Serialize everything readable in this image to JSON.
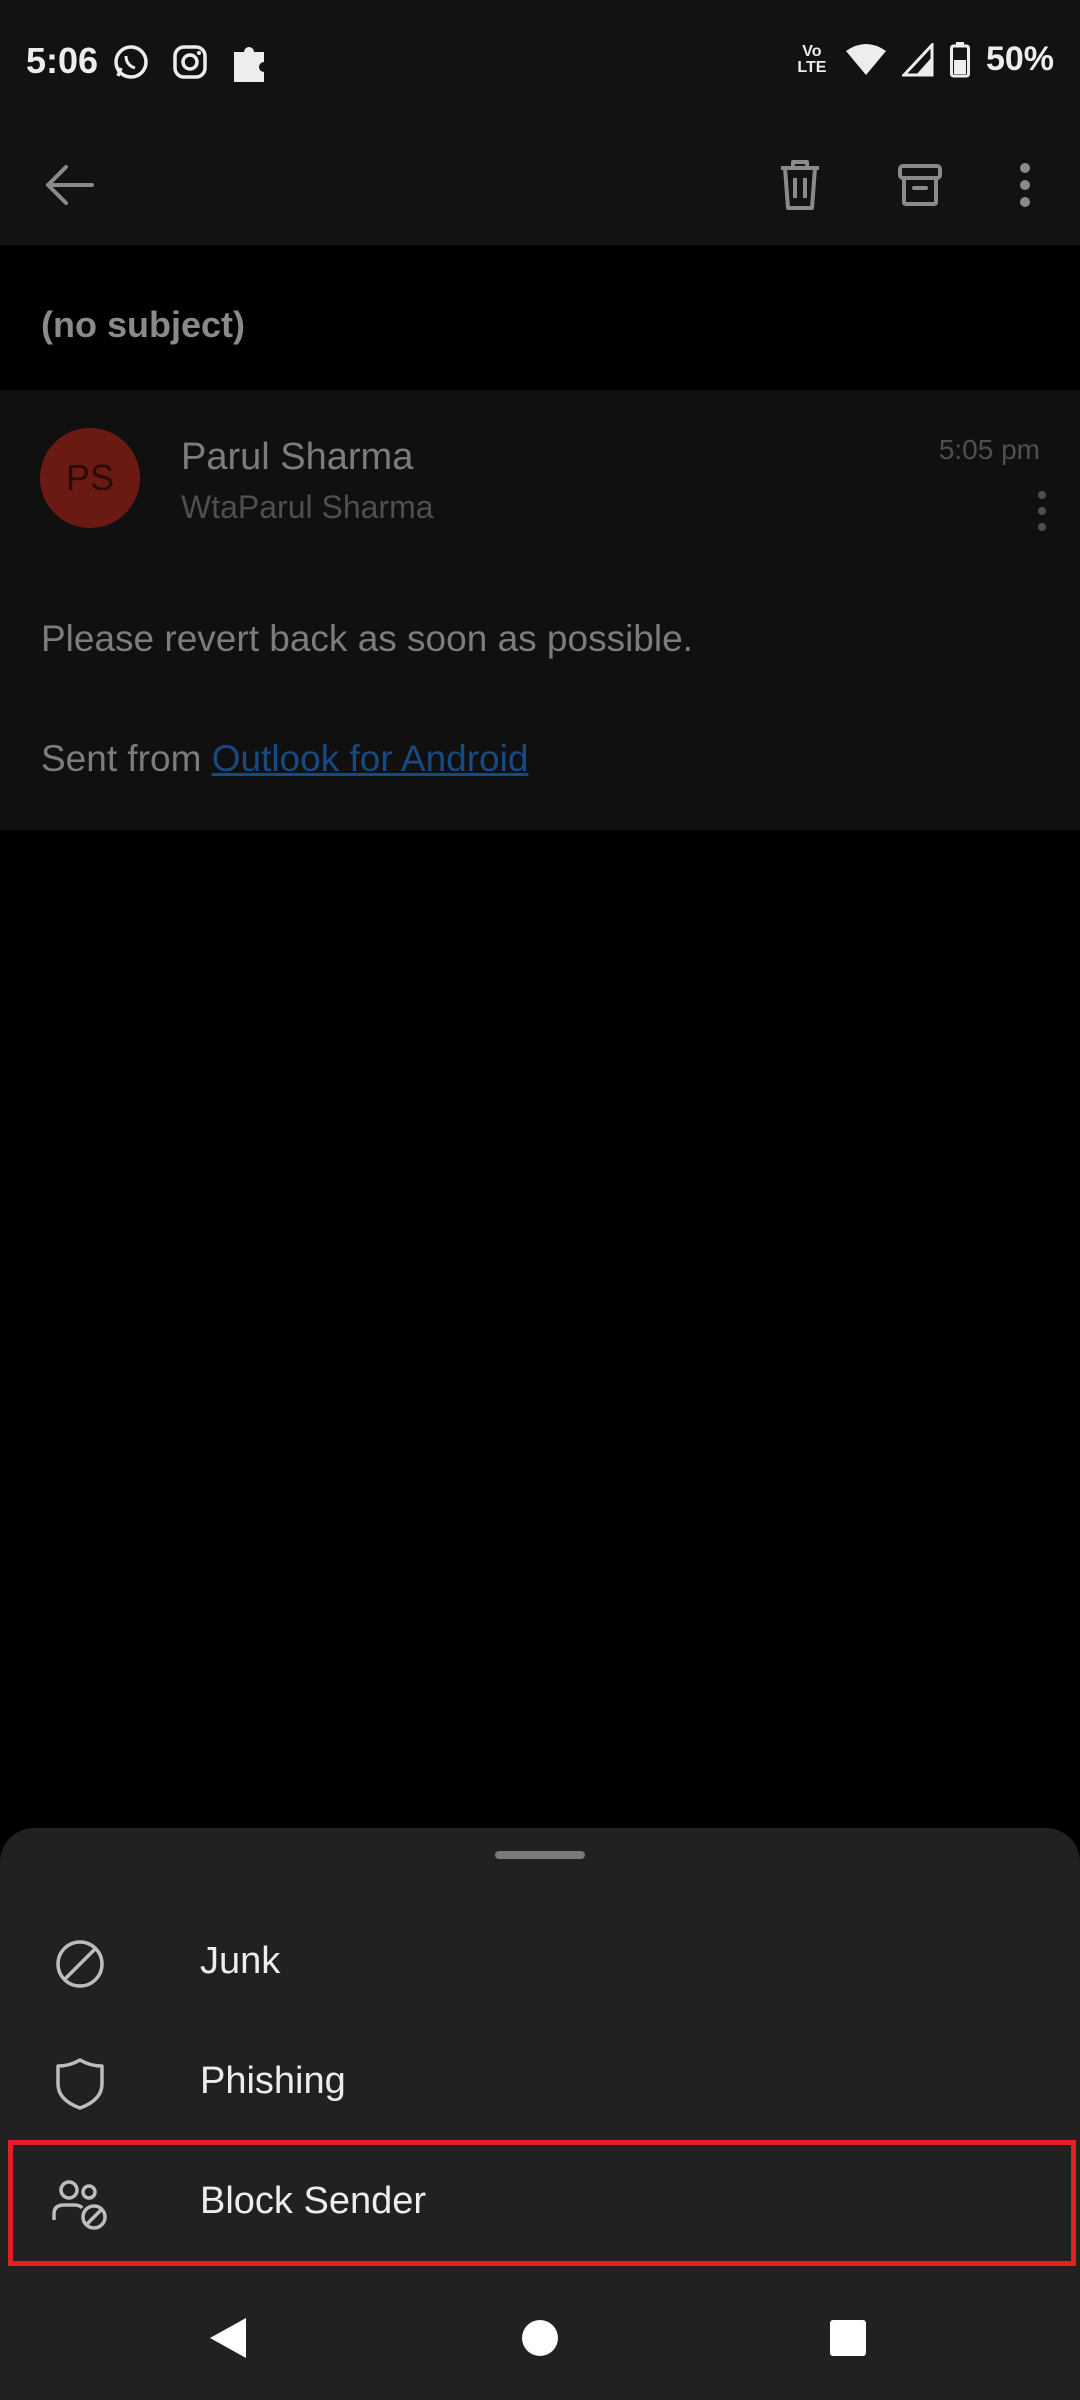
{
  "status_bar": {
    "time": "5:06",
    "battery": "50%",
    "network_label": "Vo LTE"
  },
  "app_bar": {
    "back_icon": "arrow-left-icon",
    "delete_icon": "trash-icon",
    "archive_icon": "archive-icon",
    "more_icon": "more-vertical-icon"
  },
  "email": {
    "subject": "(no subject)",
    "avatar_initials": "PS",
    "sender_name": "Parul Sharma",
    "sender_line": "WtaParul Sharma",
    "time": "5:05 pm",
    "body": "Please revert back as soon as possible.",
    "sent_prefix": "Sent from ",
    "sent_link": "Outlook for Android"
  },
  "sheet": {
    "items": [
      {
        "label": "Junk",
        "icon": "block-circle-icon"
      },
      {
        "label": "Phishing",
        "icon": "shield-icon"
      },
      {
        "label": "Block Sender",
        "icon": "block-user-icon"
      }
    ]
  },
  "colors": {
    "highlight": "#e41e26",
    "avatar": "#6b1a13",
    "link": "#174a82"
  }
}
